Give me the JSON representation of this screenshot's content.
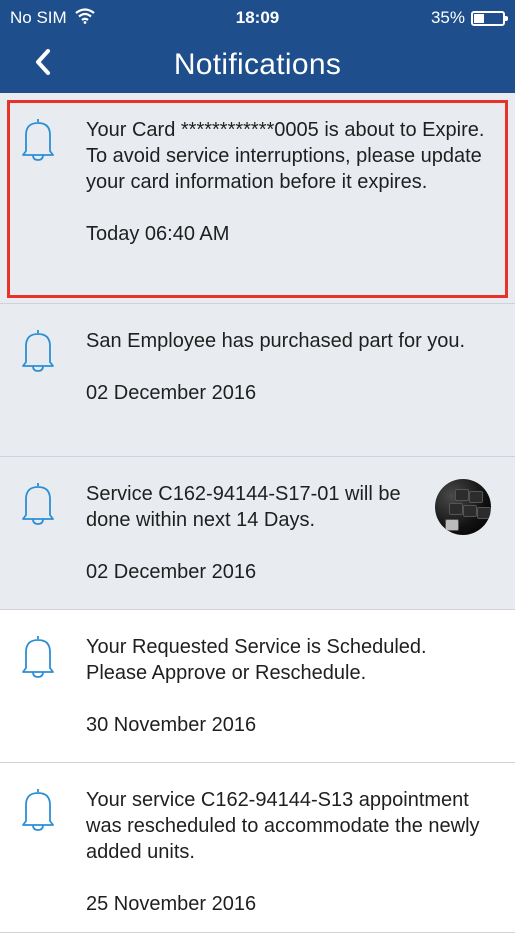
{
  "status_bar": {
    "carrier": "No SIM",
    "time": "18:09",
    "battery_percent": "35%",
    "battery_level": 0.35
  },
  "nav": {
    "title": "Notifications"
  },
  "notifications": [
    {
      "message": "Your Card ************0005 is about to Expire. To avoid service interruptions, please update your card information before it expires.",
      "time": "Today 06:40 AM"
    },
    {
      "message": "San Employee has purchased part for you.",
      "time": "02 December 2016"
    },
    {
      "message": "Service C162-94144-S17-01 will be done within next 14 Days.",
      "time": "02 December 2016"
    },
    {
      "message": "Your Requested Service is Scheduled. Please Approve or Reschedule.",
      "time": "30 November 2016"
    },
    {
      "message": "Your service C162-94144-S13 appointment was rescheduled to accommodate the newly added units.",
      "time": "25 November 2016"
    }
  ],
  "colors": {
    "header": "#1e4f8c",
    "unread_background": "#e8ecf0",
    "bell": "#2b8fd6",
    "highlight_border": "#e8332a"
  },
  "icons": {
    "back": "chevron-left-icon",
    "notification": "bell-icon",
    "wifi": "wifi-icon",
    "battery": "battery-icon"
  }
}
